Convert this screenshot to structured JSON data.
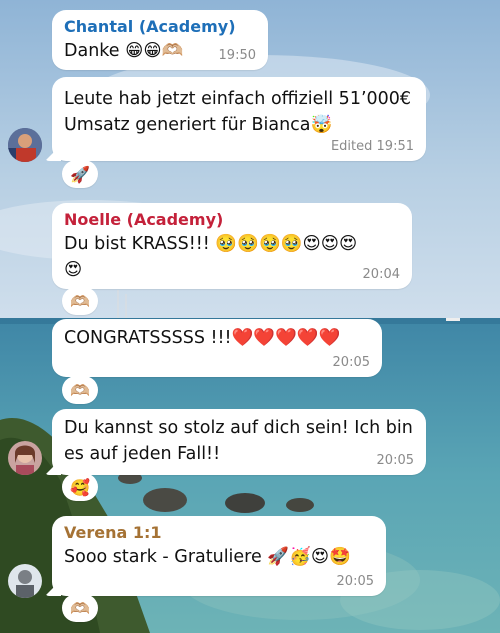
{
  "colors": {
    "chantal_name": "#1e6fb8",
    "noelle_name": "#c4213a",
    "verena_name": "#a57234",
    "time": "#8a8a8a"
  },
  "messages": [
    {
      "sender": "Chantal (Academy)",
      "text": "Danke 😁😁🫶🏼",
      "time": "19:50"
    },
    {
      "text_line1": "Leute hab jetzt einfach offiziell 51’000€",
      "text_line2": "Umsatz generiert für Bianca🤯",
      "status": "Edited 19:51",
      "reaction": "🚀"
    },
    {
      "sender": "Noelle (Academy)",
      "text_line1": "Du bist KRASS!!! 🥹🥹🥹🥹😍😍😍",
      "text_line2": "😍",
      "time": "20:04",
      "reaction": "🫶🏼"
    },
    {
      "text": "CONGRATSSSSS !!!❤️❤️❤️❤️❤️",
      "time": "20:05",
      "reaction": "🫶🏼"
    },
    {
      "text_line1": "Du kannst so stolz auf dich sein! Ich bin",
      "text_line2": "es auf jeden Fall!!",
      "time": "20:05",
      "reaction": "🥰"
    },
    {
      "sender": "Verena 1:1",
      "text": "Sooo stark - Gratuliere 🚀🥳😍🤩",
      "time": "20:05",
      "reaction": "🫶🏼"
    }
  ]
}
